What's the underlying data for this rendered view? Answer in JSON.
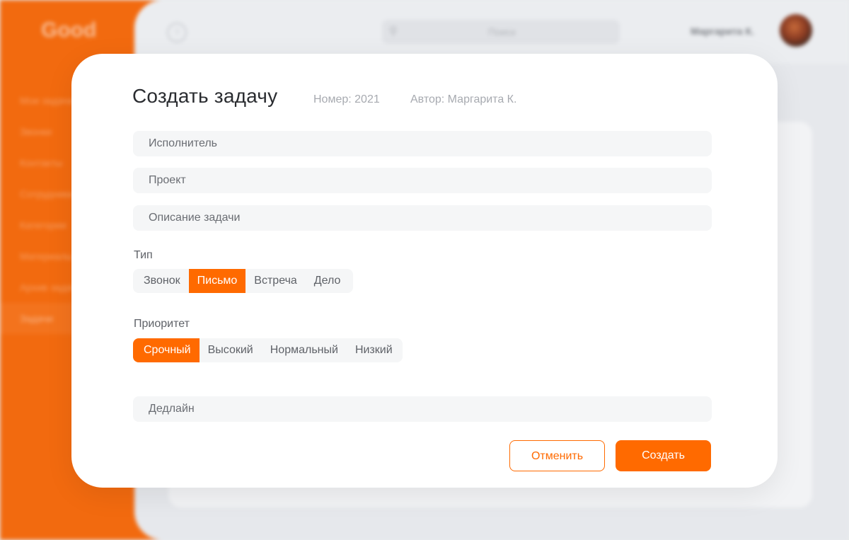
{
  "background": {
    "logo": "Good",
    "nav_items": [
      "Мои задачи",
      "Звонки",
      "Контакты",
      "Сотрудники",
      "Категории",
      "Материалы",
      "Архив задач",
      "Задачи"
    ],
    "search_placeholder": "Поиск",
    "user_name": "Маргарита К."
  },
  "modal": {
    "title": "Создать задачу",
    "number": "Номер: 2021",
    "author": "Автор: Маргарита К.",
    "fields": {
      "assignee_placeholder": "Исполнитель",
      "project_placeholder": "Проект",
      "description_placeholder": "Описание задачи",
      "deadline_placeholder": "Дедлайн"
    },
    "type": {
      "label": "Тип",
      "options": [
        "Звонок",
        "Письмо",
        "Встреча",
        "Дело"
      ],
      "selected": "Письмо"
    },
    "priority": {
      "label": "Приоритет",
      "options": [
        "Срочный",
        "Высокий",
        "Нормальный",
        "Низкий"
      ],
      "selected": "Срочный"
    },
    "buttons": {
      "cancel": "Отменить",
      "create": "Создать"
    }
  },
  "colors": {
    "accent": "#ff6a00",
    "sidebar": "#f26a0f",
    "field_bg": "#f5f6f7"
  }
}
